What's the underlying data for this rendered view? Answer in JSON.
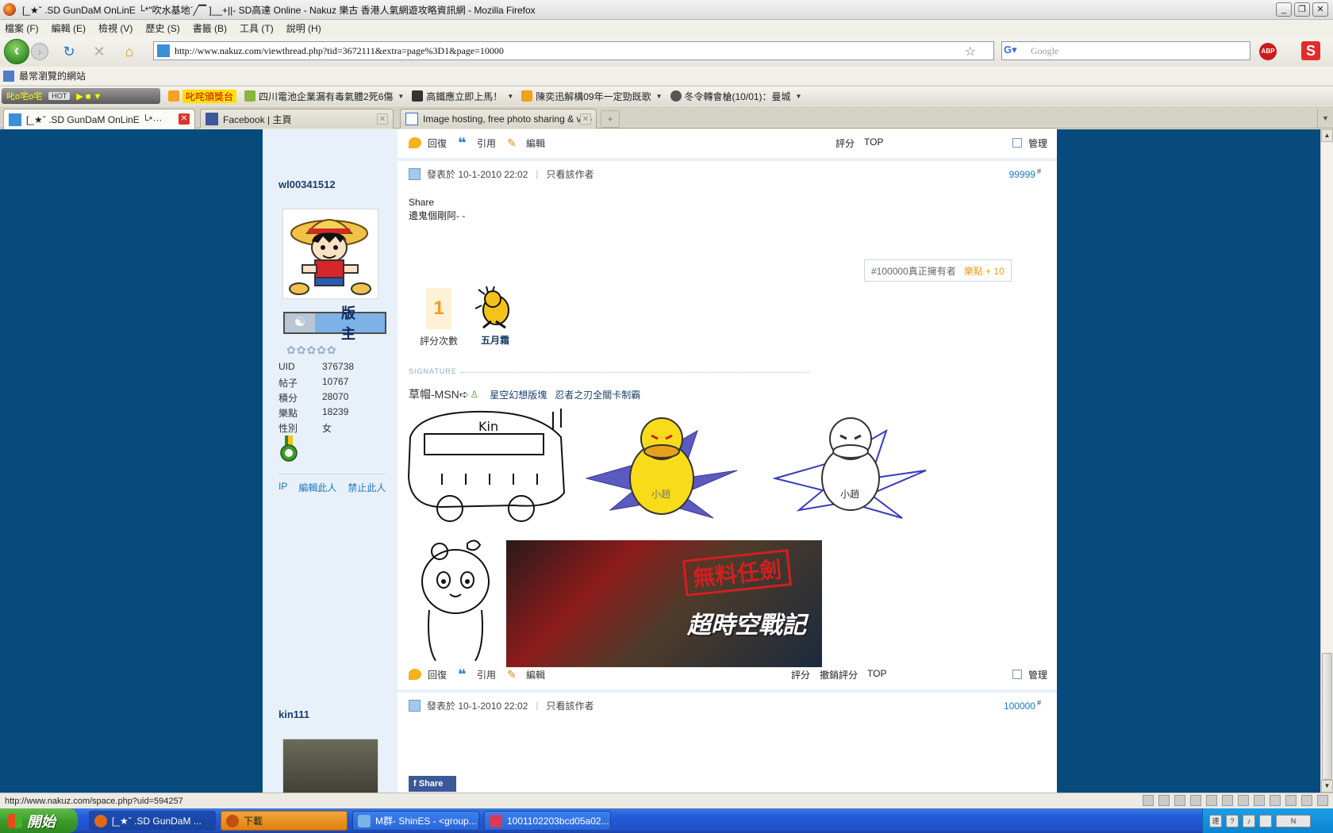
{
  "window": {
    "title": "[_★ˇ .SD GunDaM OnLinE └*\"吹水基地ˊ╱▔ ]__+||- SD高達 Online - Nakuz 樂古 香港人氣網遊攻略資訊網 - Mozilla Firefox",
    "buttons": [
      "_",
      "❐",
      "✕"
    ]
  },
  "menu": [
    "檔案 (F)",
    "編輯 (E)",
    "檢視 (V)",
    "歷史 (S)",
    "書籤 (B)",
    "工具 (T)",
    "說明 (H)"
  ],
  "nav": {
    "url": "http://www.nakuz.com/viewthread.php?tid=3672111&extra=page%3D1&page=10000",
    "search_placeholder": "Google",
    "abp_label": "ABP",
    "s_label": "S"
  },
  "bookmarks": {
    "most_visited": "最常瀏覽的網站"
  },
  "toolbar2": {
    "radio_label": "叱o宅o宅",
    "hot_label": "HOT",
    "items": [
      {
        "label": "叱咤頒獎台",
        "highlight": true
      },
      {
        "label": "四川電池企業漏有毒氣體2死6傷",
        "dropdown": true
      },
      {
        "label": "高鐵應立即上馬！",
        "dropdown": true
      },
      {
        "label": "陳奕迅解構09年一定勁既歌",
        "dropdown": true
      },
      {
        "label": "冬令轉會槍(10/01)：曼城",
        "dropdown": true
      }
    ]
  },
  "tabs": [
    {
      "label": "[_★ˇ .SD GunDaM OnLinE └*···",
      "active": true
    },
    {
      "label": "Facebook | 主頁",
      "active": false
    },
    {
      "label": "Image hosting, free photo sharing & vi···",
      "active": false
    }
  ],
  "forum": {
    "actions": {
      "reply": "回復",
      "quote": "引用",
      "edit": "編輯",
      "rate": "評分",
      "undo_rate": "撤銷評分",
      "top": "TOP",
      "manage": "管理"
    },
    "post1": {
      "username": "wl00341512",
      "rank_badge": "版 主",
      "stats": [
        {
          "key": "UID",
          "value": "376738"
        },
        {
          "key": "帖子",
          "value": "10767"
        },
        {
          "key": "積分",
          "value": "28070"
        },
        {
          "key": "樂點",
          "value": "18239"
        },
        {
          "key": "性別",
          "value": "女"
        }
      ],
      "side_links": [
        "IP",
        "編輯此人",
        "禁止此人"
      ],
      "posted_at": "發表於 10-1-2010 22:02",
      "only_author": "只看該作者",
      "floor": "99999",
      "floor_mark": "#",
      "body_lines": [
        "Share",
        "邊鬼個剛阿- -"
      ],
      "rate_tip": "#100000真正擁有者",
      "rate_points": "樂點 + 10",
      "rate_count": "1",
      "rate_count_label": "評分次數",
      "rater": "五月霜",
      "signature_title": "SIGNATURE",
      "signature_text": "草帽-MSN➪",
      "signature_links": [
        "星空幻想版塊",
        "忍者之刃全關卡制霸"
      ],
      "banner_stamp": "無料任劍",
      "banner_logo": "超時空戰記"
    },
    "post2": {
      "username": "kin111",
      "posted_at": "發表於 10-1-2010 22:02",
      "only_author": "只看該作者",
      "floor": "100000",
      "floor_mark": "#",
      "share_label": "Share"
    }
  },
  "status": {
    "text": "http://www.nakuz.com/space.php?uid=594257"
  },
  "taskbar": {
    "start": "開始",
    "tasks": [
      {
        "label": "[_★ˇ .SD GunDaM ...",
        "active": true
      },
      {
        "label": "下載",
        "orange": true
      },
      {
        "label": "M群- ShinES - <group..."
      },
      {
        "label": "1001102203bcd05a02..."
      }
    ]
  }
}
